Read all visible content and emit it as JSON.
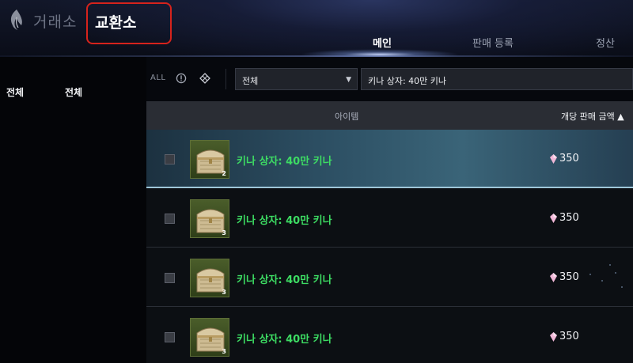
{
  "header": {
    "app_title": "거래소",
    "exchange_title": "교환소",
    "tabs": [
      {
        "label": "메인",
        "active": true
      },
      {
        "label": "판매 등록",
        "active": false
      },
      {
        "label": "정산",
        "active": false
      }
    ]
  },
  "sidebar": {
    "category": "전체",
    "subcategory": "전체"
  },
  "filters": {
    "all_label": "ALL",
    "select_value": "전체",
    "search_value": "키나 상자: 40만 키나"
  },
  "table": {
    "columns": {
      "item": "아이템",
      "price": "개당 판매 금액 ▲"
    },
    "rows": [
      {
        "name": "키나 상자: 40만 키나",
        "count": "2",
        "price": "350",
        "selected": true
      },
      {
        "name": "키나 상자: 40만 키나",
        "count": "3",
        "price": "350",
        "selected": false
      },
      {
        "name": "키나 상자: 40만 키나",
        "count": "3",
        "price": "350",
        "selected": false
      },
      {
        "name": "키나 상자: 40만 키나",
        "count": "3",
        "price": "350",
        "selected": false
      }
    ]
  },
  "colors": {
    "item_name": "#3ddc63",
    "highlight_border": "#d6231c",
    "selected_row": "#3a6478"
  },
  "icons": [
    "logo-icon",
    "info-circle-icon",
    "diamond-grid-icon",
    "chevron-down-icon",
    "chest-icon",
    "currency-gem-icon"
  ]
}
